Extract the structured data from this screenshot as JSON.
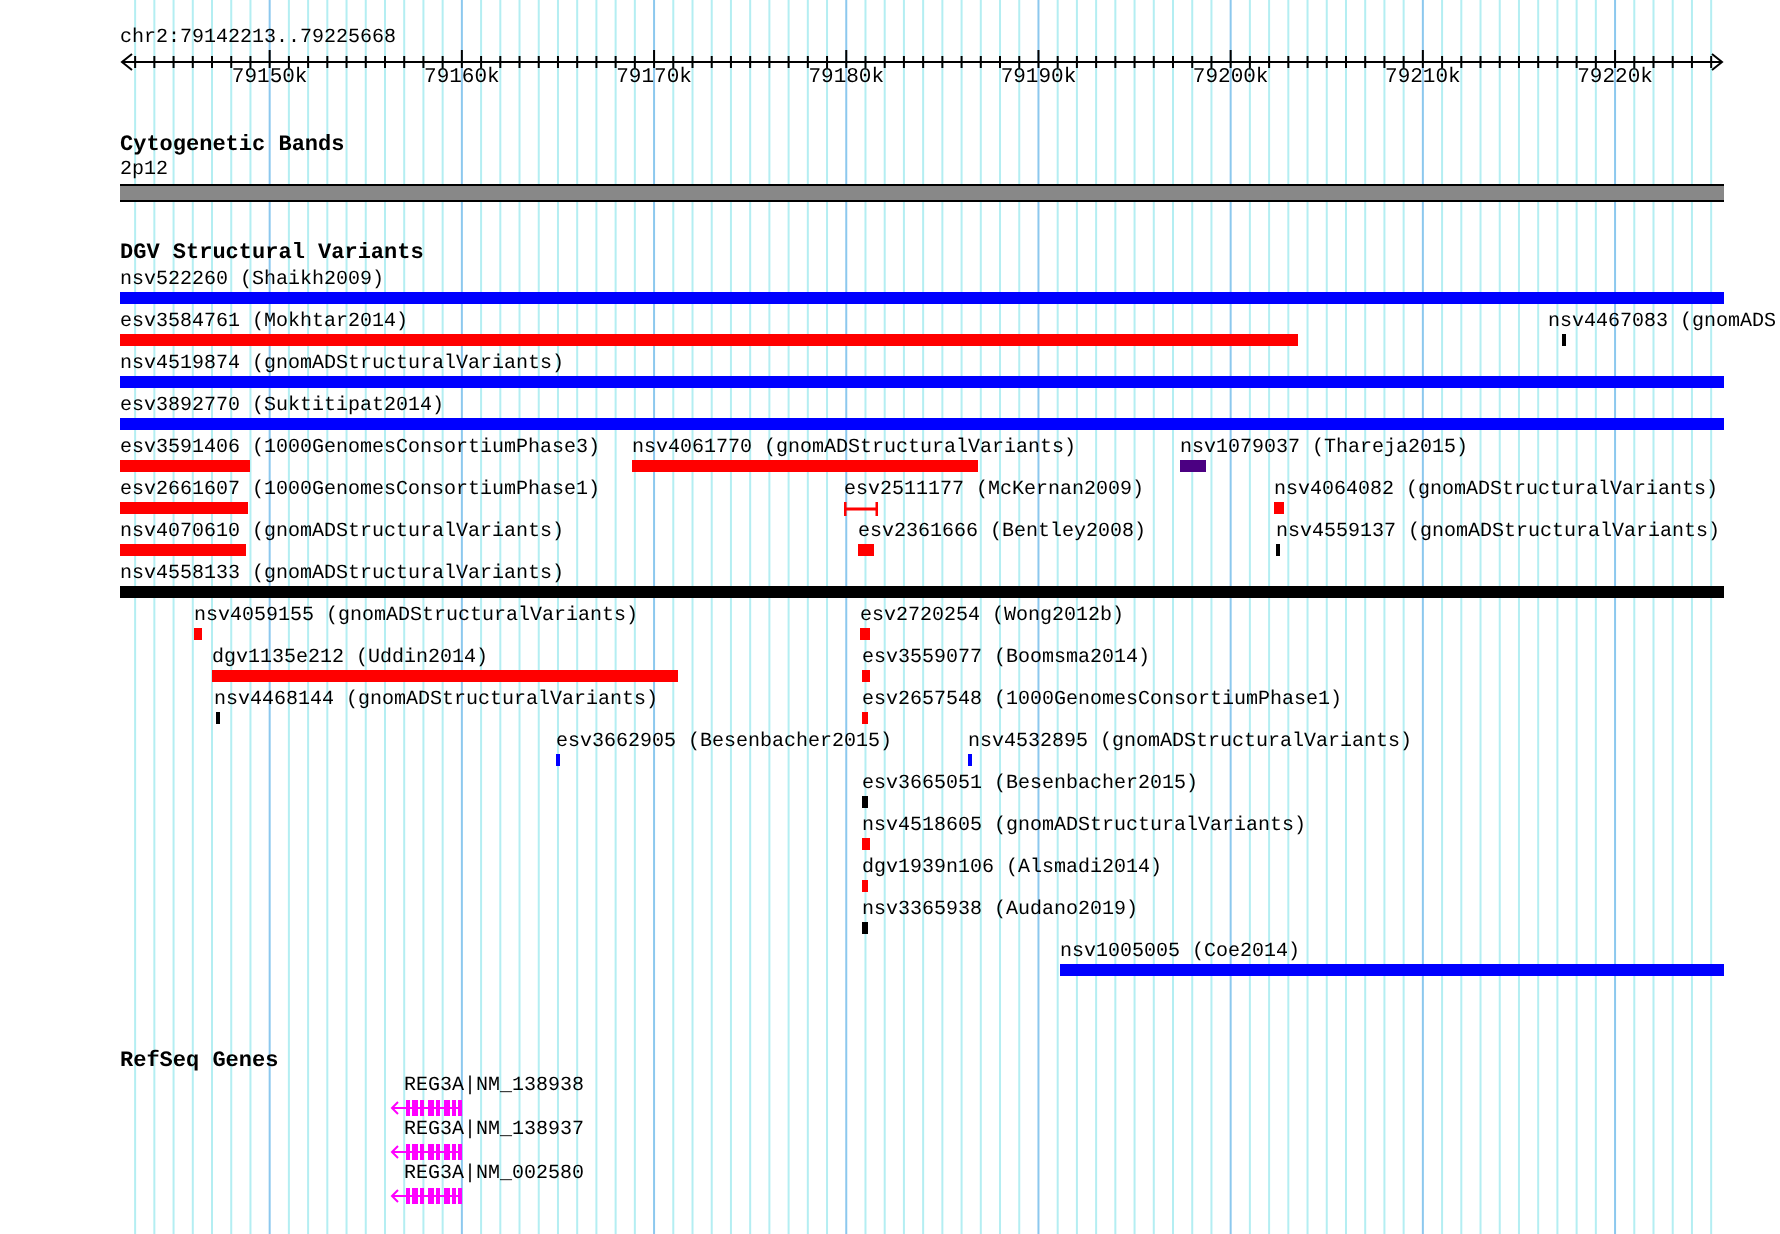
{
  "ruler": {
    "location": "chr2:79142213..79225668",
    "ticks": [
      "79150k",
      "79160k",
      "79170k",
      "79180k",
      "79190k",
      "79200k",
      "79210k",
      "79220k"
    ]
  },
  "tracks": [
    {
      "title": "Cytogenetic Bands",
      "kind": "bands",
      "features": [
        {
          "label": "2p12"
        }
      ]
    },
    {
      "title": "DGV Structural Variants",
      "kind": "variants",
      "features": [
        {
          "label": "nsv522260 (Shaikh2009)",
          "kind": "bar",
          "color": "#0000ff"
        },
        {
          "label": "esv3584761 (Mokhtar2014)",
          "kind": "bar",
          "color": "#ff0000"
        },
        {
          "label": "nsv4467083 (gnomADS",
          "kind": "bar",
          "color": "#000000"
        },
        {
          "label": "nsv4519874 (gnomADStructuralVariants)",
          "kind": "bar",
          "color": "#0000ff"
        },
        {
          "label": "esv3892770 (Suktitipat2014)",
          "kind": "bar",
          "color": "#0000ff"
        },
        {
          "label": "esv3591406 (1000GenomesConsortiumPhase3)",
          "kind": "bar",
          "color": "#ff0000"
        },
        {
          "label": "nsv4061770 (gnomADStructuralVariants)",
          "kind": "bar",
          "color": "#ff0000"
        },
        {
          "label": "nsv1079037 (Thareja2015)",
          "kind": "bar",
          "color": "#4b0082"
        },
        {
          "label": "esv2661607 (1000GenomesConsortiumPhase1)",
          "kind": "bar",
          "color": "#ff0000"
        },
        {
          "label": "esv2511177 (McKernan2009)",
          "kind": "interval",
          "color": "#ff0000"
        },
        {
          "label": "nsv4064082 (gnomADStructuralVariants)",
          "kind": "bar",
          "color": "#ff0000"
        },
        {
          "label": "nsv4070610 (gnomADStructuralVariants)",
          "kind": "bar",
          "color": "#ff0000"
        },
        {
          "label": "esv2361666 (Bentley2008)",
          "kind": "bar",
          "color": "#ff0000"
        },
        {
          "label": "nsv4559137 (gnomADStructuralVariants)",
          "kind": "bar",
          "color": "#000000"
        },
        {
          "label": "nsv4558133 (gnomADStructuralVariants)",
          "kind": "bar",
          "color": "#000000"
        },
        {
          "label": "nsv4059155 (gnomADStructuralVariants)",
          "kind": "bar",
          "color": "#ff0000"
        },
        {
          "label": "esv2720254 (Wong2012b)",
          "kind": "bar",
          "color": "#ff0000"
        },
        {
          "label": "dgv1135e212 (Uddin2014)",
          "kind": "bar",
          "color": "#ff0000"
        },
        {
          "label": "esv3559077 (Boomsma2014)",
          "kind": "bar",
          "color": "#ff0000"
        },
        {
          "label": "nsv4468144 (gnomADStructuralVariants)",
          "kind": "bar",
          "color": "#000000"
        },
        {
          "label": "esv2657548 (1000GenomesConsortiumPhase1)",
          "kind": "bar",
          "color": "#ff0000"
        },
        {
          "label": "esv3662905 (Besenbacher2015)",
          "kind": "bar",
          "color": "#0000ff"
        },
        {
          "label": "nsv4532895 (gnomADStructuralVariants)",
          "kind": "bar",
          "color": "#0000ff"
        },
        {
          "label": "esv3665051 (Besenbacher2015)",
          "kind": "bar",
          "color": "#000000"
        },
        {
          "label": "nsv4518605 (gnomADStructuralVariants)",
          "kind": "bar",
          "color": "#ff0000"
        },
        {
          "label": "dgv1939n106 (Alsmadi2014)",
          "kind": "bar",
          "color": "#ff0000"
        },
        {
          "label": "nsv3365938 (Audano2019)",
          "kind": "bar",
          "color": "#000000"
        },
        {
          "label": "nsv1005005 (Coe2014)",
          "kind": "bar",
          "color": "#0000ff"
        }
      ]
    },
    {
      "title": "RefSeq Genes",
      "kind": "genes",
      "features": [
        {
          "label": "REG3A|NM_138938"
        },
        {
          "label": "REG3A|NM_138937"
        },
        {
          "label": "REG3A|NM_002580"
        }
      ]
    }
  ]
}
